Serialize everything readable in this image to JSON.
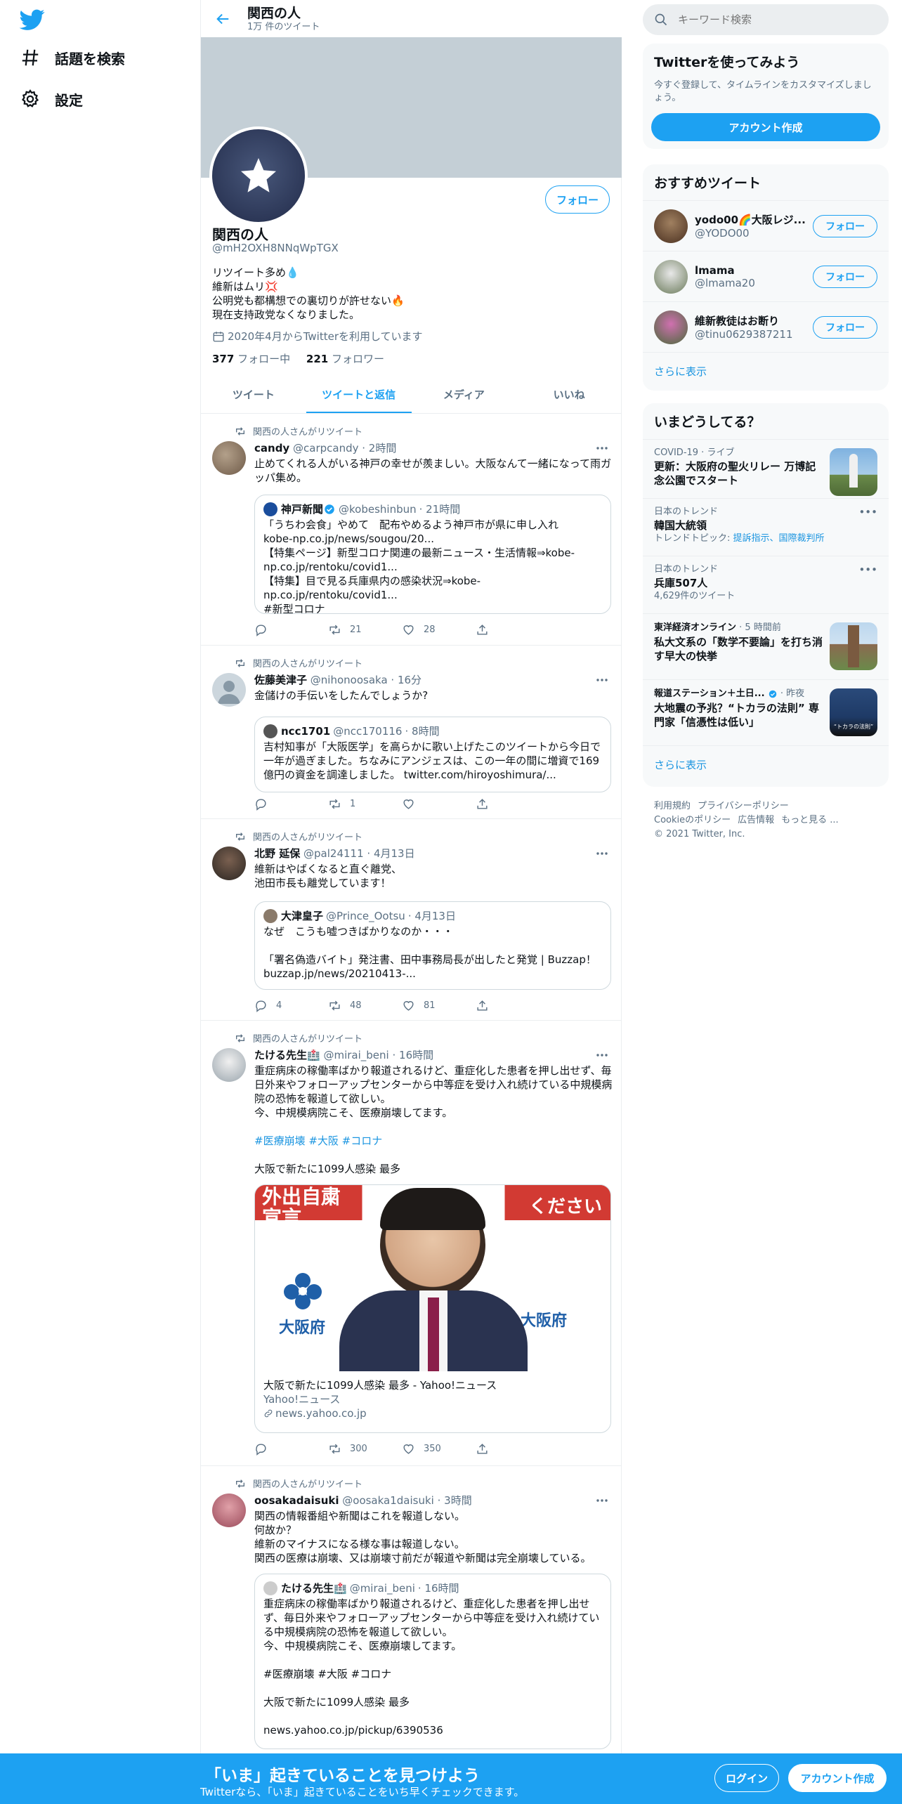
{
  "nav": {
    "explore_label": "話題を検索",
    "settings_label": "設定"
  },
  "header": {
    "title": "関西の人",
    "tweet_count": "1万 件のツイート"
  },
  "profile": {
    "name": "関西の人",
    "handle": "@mH2OXH8NNqWpTGX",
    "follow_label": "フォロー",
    "bio": [
      "リツイート多め💧",
      "維新はムリ💢",
      "公明党も都構想での裏切りが許せない🔥",
      "現在支持政党なくなりました。"
    ],
    "joined": "2020年4月からTwitterを利用しています",
    "following_count": "377",
    "following_label": "フォロー中",
    "followers_count": "221",
    "followers_label": "フォロワー"
  },
  "tabs": [
    "ツイート",
    "ツイートと返信",
    "メディア",
    "いいね"
  ],
  "tweets": [
    {
      "retweet_label": "関西の人さんがリツイート",
      "name": "candy",
      "handle": "@carpcandy",
      "time": "· 2時間",
      "text": "止めてくれる人がいる神戸の幸せが羨ましい。大阪なんて一緒になって雨ガッパ集め。",
      "quote": {
        "name": "神戸新聞",
        "handle": "@kobeshinbun",
        "time": "· 21時間",
        "lines": [
          "「うちわ会食」やめて　配布やめるよう神戸市が県に申し入れ",
          "kobe-np.co.jp/news/sougou/20...",
          "【特集ページ】新型コロナ関連の最新ニュース・生活情報⇒kobe-np.co.jp/rentoku/covid1...",
          "【特集】目で見る兵庫県内の感染状況⇒kobe-np.co.jp/rentoku/covid1...",
          "#新型コロナ"
        ]
      },
      "retweets": "21",
      "likes": "28"
    },
    {
      "retweet_label": "関西の人さんがリツイート",
      "name": "佐藤美津子",
      "handle": "@nihonoosaka",
      "time": "· 16分",
      "text": "金儲けの手伝いをしたんでしょうか?",
      "quote": {
        "name": "ncc1701",
        "handle": "@ncc170116",
        "time": "· 8時間",
        "text": "吉村知事が「大阪医学」を高らかに歌い上げたこのツイートから今日で一年が過ぎました。ちなみにアンジェスは、この一年の間に増資で169億円の資金を調達しました。 twitter.com/hiroyoshimura/..."
      },
      "retweets": "1",
      "likes": ""
    },
    {
      "retweet_label": "関西の人さんがリツイート",
      "name": "北野 延保",
      "handle": "@pal24111",
      "time": "· 4月13日",
      "lines": [
        "維新はやばくなると直ぐ離党、",
        "池田市長も離党しています！"
      ],
      "quote": {
        "name": "大津皇子",
        "handle": "@Prince_Ootsu",
        "time": "· 4月13日",
        "lines": [
          "なぜ　こうも嘘つきばかりなのか・・・",
          "",
          "「署名偽造バイト」発注書、田中事務局長が出したと発覚 | Buzzap！ buzzap.jp/news/20210413-..."
        ]
      },
      "replies": "4",
      "retweets": "48",
      "likes": "81"
    },
    {
      "retweet_label": "関西の人さんがリツイート",
      "name": "たける先生🏥",
      "handle": "@mirai_beni",
      "time": "· 16時間",
      "text": "重症病床の稼働率ばかり報道されるけど、重症化した患者を押し出せず、毎日外来やフォローアップセンターから中等症を受け入れ続けている中規模病院の恐怖を報道して欲しい。",
      "text2": "今、中規模病院こそ、医療崩壊してます。",
      "hashtags": "#医療崩壊 #大阪 #コロナ",
      "headline": "大阪で新たに1099人感染 最多",
      "card": {
        "title": "大阪で新たに1099人感染 最多 - Yahoo!ニュース",
        "desc": "Yahoo!ニュース",
        "domain": "news.yahoo.co.jp",
        "sign_left": "外出自粛\n宣言",
        "sign_right": "ください",
        "pref_label": "大阪府"
      },
      "retweets": "300",
      "likes": "350"
    },
    {
      "retweet_label": "関西の人さんがリツイート",
      "name": "oosakadaisuki",
      "handle": "@oosaka1daisuki",
      "time": "· 3時間",
      "lines": [
        "関西の情報番組や新聞はこれを報道しない。",
        "何故か？",
        "維新のマイナスになる様な事は報道しない。",
        "関西の医療は崩壊、又は崩壊寸前だが報道や新聞は完全崩壊している。"
      ],
      "quote": {
        "name": "たける先生🏥",
        "handle": "@mirai_beni",
        "time": "· 16時間",
        "lines": [
          "重症病床の稼働率ばかり報道されるけど、重症化した患者を押し出せず、毎日外来やフォローアップセンターから中等症を受け入れ続けている中規模病院の恐怖を報道して欲しい。",
          "今、中規模病院こそ、医療崩壊してます。",
          "",
          "#医療崩壊 #大阪 #コロナ",
          "",
          "大阪で新たに1099人感染 最多",
          "",
          "news.yahoo.co.jp/pickup/6390536"
        ]
      }
    }
  ],
  "search": {
    "placeholder": "キーワード検索"
  },
  "signup_panel": {
    "title": "Twitterを使ってみよう",
    "desc": "今すぐ登録して、タイムラインをカスタマイズしましょう。",
    "button": "アカウント作成"
  },
  "who_to_follow": {
    "title": "おすすめツイート",
    "users": [
      {
        "name": "yodo00🌈大阪レジ...",
        "handle": "@YODO00",
        "button": "フォロー"
      },
      {
        "name": "lmama",
        "handle": "@lmama20",
        "button": "フォロー"
      },
      {
        "name": "維新教徒はお断り",
        "handle": "@tinu0629387211",
        "button": "フォロー"
      }
    ],
    "more": "さらに表示"
  },
  "trends": {
    "title": "いまどうしてる？",
    "items": [
      {
        "meta": "COVID-19 · ライブ",
        "title": "更新：大阪府の聖火リレー 万博記念公園でスタート"
      },
      {
        "meta": "日本のトレンド",
        "title": "韓国大統領",
        "sub_prefix": "トレンドトピック: ",
        "sub_links": "提訴指示、国際裁判所"
      },
      {
        "meta": "日本のトレンド",
        "title": "兵庫507人",
        "sub": "4,629件のツイート"
      },
      {
        "meta_source": "東洋経済オンライン",
        "meta_time": "· 5 時間前",
        "title": "私大文系の「数学不要論」を打ち消す早大の快挙"
      },
      {
        "meta_source": "報道ステーション＋土日...",
        "meta_time": "· 昨夜",
        "title": "大地震の予兆？“トカラの法則” 専門家「信憑性は低い」",
        "thumb_caption": "“トカラの法則”"
      }
    ],
    "more": "さらに表示"
  },
  "footer": {
    "links": [
      "利用規約",
      "プライバシーポリシー",
      "Cookieのポリシー",
      "広告情報",
      "もっと見る ..."
    ],
    "copyright": "© 2021 Twitter, Inc."
  },
  "bottom_bar": {
    "title": "「いま」起きていることを見つけよう",
    "subtitle": "Twitterなら、「いま」起きていることをいち早くチェックできます。",
    "login": "ログイン",
    "signup": "アカウント作成"
  },
  "colors": {
    "accent": "#1da1f2",
    "banner": "#c4cfd6",
    "bottom_bar": "#1da1f2"
  }
}
